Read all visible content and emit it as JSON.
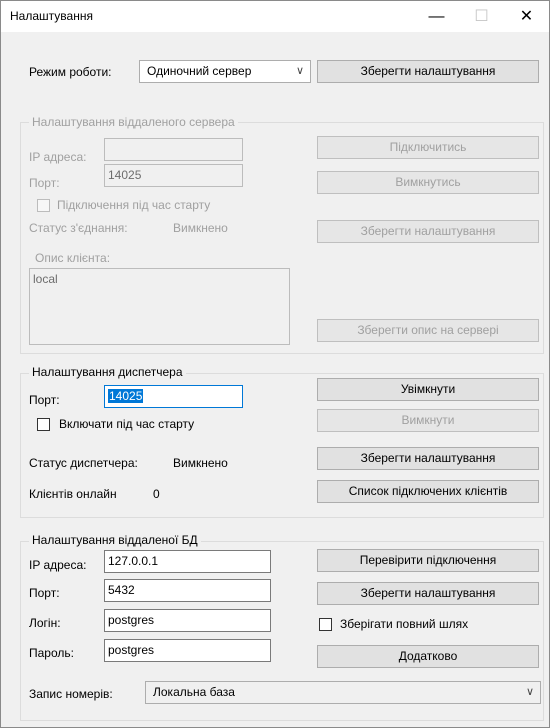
{
  "window": {
    "title": "Налаштування",
    "minimize": "—",
    "maximize": "☐",
    "close": "✕"
  },
  "top": {
    "mode_label": "Режим роботи:",
    "mode_value": "Одиночний сервер",
    "save_button": "Зберегти налаштування"
  },
  "remote_server": {
    "title": "Налаштування віддаленого сервера",
    "ip_label": "IP адреса:",
    "ip_value": "",
    "port_label": "Порт:",
    "port_value": "14025",
    "connect_on_start_label": "Підключення під час старту",
    "status_label": "Статус з'єднання:",
    "status_value": "Вимкнено",
    "client_desc_label": "Опис клієнта:",
    "client_desc_value": "local",
    "connect_button": "Підключитись",
    "disconnect_button": "Вимкнутись",
    "save_button": "Зберегти налаштування",
    "save_desc_button": "Зберегти опис на сервері"
  },
  "dispatcher": {
    "title": "Налаштування диспетчера",
    "port_label": "Порт:",
    "port_value": "14025",
    "enable_on_start_label": "Включати під час старту",
    "status_label": "Статус диспетчера:",
    "status_value": "Вимкнено",
    "clients_label": "Клієнтів онлайн",
    "clients_value": "0",
    "enable_button": "Увімкнути",
    "disable_button": "Вимкнути",
    "save_button": "Зберегти налаштування",
    "clients_list_button": "Список підключених клієнтів"
  },
  "remote_db": {
    "title": "Налаштування віддаленої БД",
    "ip_label": "IP адреса:",
    "ip_value": "127.0.0.1",
    "port_label": "Порт:",
    "port_value": "5432",
    "login_label": "Логін:",
    "login_value": "postgres",
    "password_label": "Пароль:",
    "password_value": "postgres",
    "check_button": "Перевірити підключення",
    "save_button": "Зберегти налаштування",
    "save_full_path_label": "Зберігати повний шлях",
    "advanced_button": "Додатково",
    "records_label": "Запис номерів:",
    "records_value": "Локальна база"
  }
}
